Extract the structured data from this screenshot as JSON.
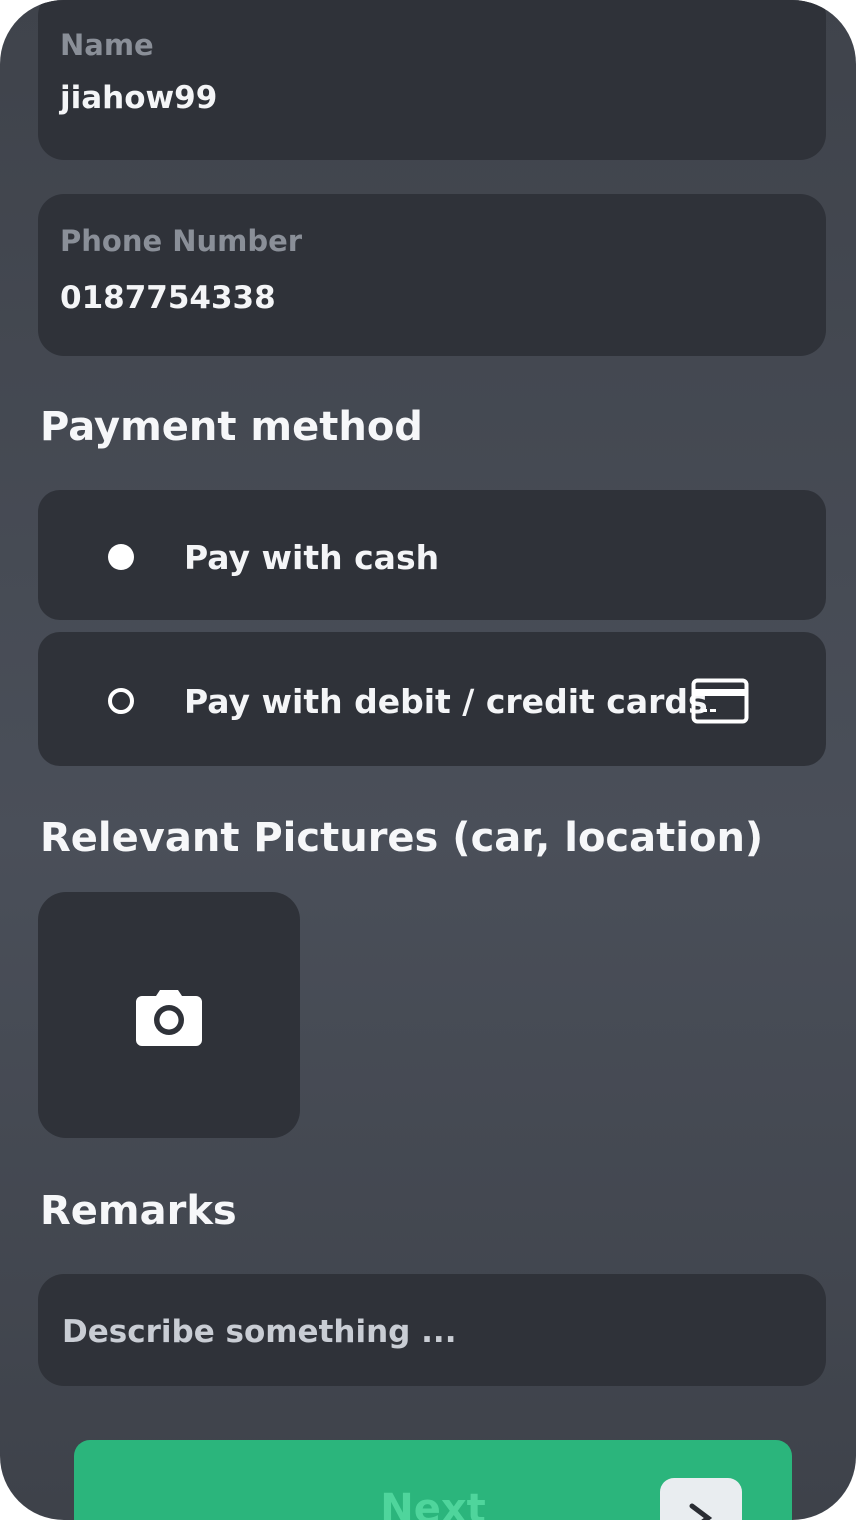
{
  "form": {
    "name_label": "Name",
    "name_value": "jiahow99",
    "phone_label": "Phone Number",
    "phone_value": "0187754338"
  },
  "payment": {
    "title": "Payment method",
    "options": [
      {
        "label": "Pay with cash",
        "selected": true
      },
      {
        "label": "Pay with debit / credit cards",
        "selected": false,
        "icon": "credit-card-icon"
      }
    ]
  },
  "pictures": {
    "title": "Relevant Pictures (car, location)",
    "add_icon": "camera-icon"
  },
  "remarks": {
    "title": "Remarks",
    "placeholder": "Describe something ..."
  },
  "next_button": {
    "label": "Next",
    "icon": "chevron-right-icon"
  },
  "colors": {
    "background": "#454a53",
    "card": "#2f3239",
    "accent": "#2bb57c",
    "text": "#f4f5f7",
    "muted": "#8a8f98"
  }
}
